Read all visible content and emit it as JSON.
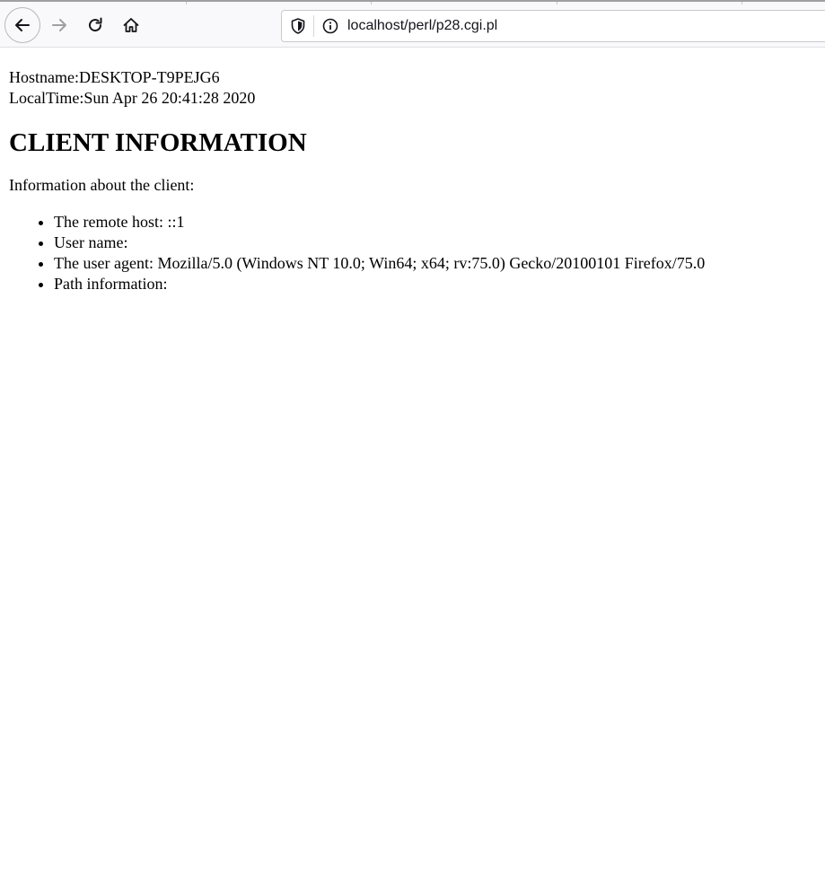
{
  "browser": {
    "url": "localhost/perl/p28.cgi.pl",
    "icons": {
      "back": "arrow-left-icon",
      "forward": "arrow-right-icon",
      "reload": "reload-icon",
      "home": "home-icon",
      "shield": "shield-icon",
      "info": "info-icon"
    }
  },
  "page": {
    "hostname": "Hostname:DESKTOP-T9PEJG6",
    "localtime": "LocalTime:Sun Apr 26 20:41:28 2020",
    "heading": "CLIENT INFORMATION",
    "intro": "Information about the client:",
    "items": [
      "The remote host: ::1",
      "User name:",
      "The user agent: Mozilla/5.0 (Windows NT 10.0; Win64; x64; rv:75.0) Gecko/20100101 Firefox/75.0",
      "Path information:"
    ]
  }
}
